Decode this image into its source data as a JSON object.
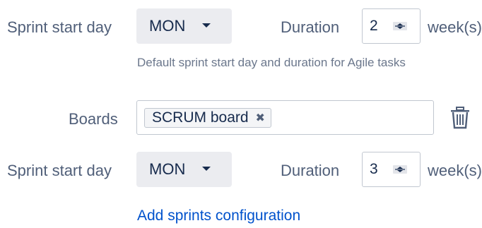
{
  "rows": [
    {
      "start_day_label": "Sprint start day",
      "start_day_value": "MON",
      "duration_label": "Duration",
      "duration_value": "2",
      "duration_unit": "week(s)"
    },
    {
      "start_day_label": "Sprint start day",
      "start_day_value": "MON",
      "duration_label": "Duration",
      "duration_value": "3",
      "duration_unit": "week(s)"
    }
  ],
  "default_helper_text": "Default sprint start day and duration for Agile tasks",
  "boards": {
    "label": "Boards",
    "tags": [
      "SCRUM board"
    ],
    "remove_tag_glyph": "✖"
  },
  "add_link_text": "Add sprints configuration",
  "colors": {
    "link": "#0052cc",
    "select_bg": "#ebecf0",
    "border": "#c1c7d0"
  },
  "icons": [
    "caret-down-icon",
    "spinner-icon",
    "close-icon",
    "trash-icon"
  ]
}
